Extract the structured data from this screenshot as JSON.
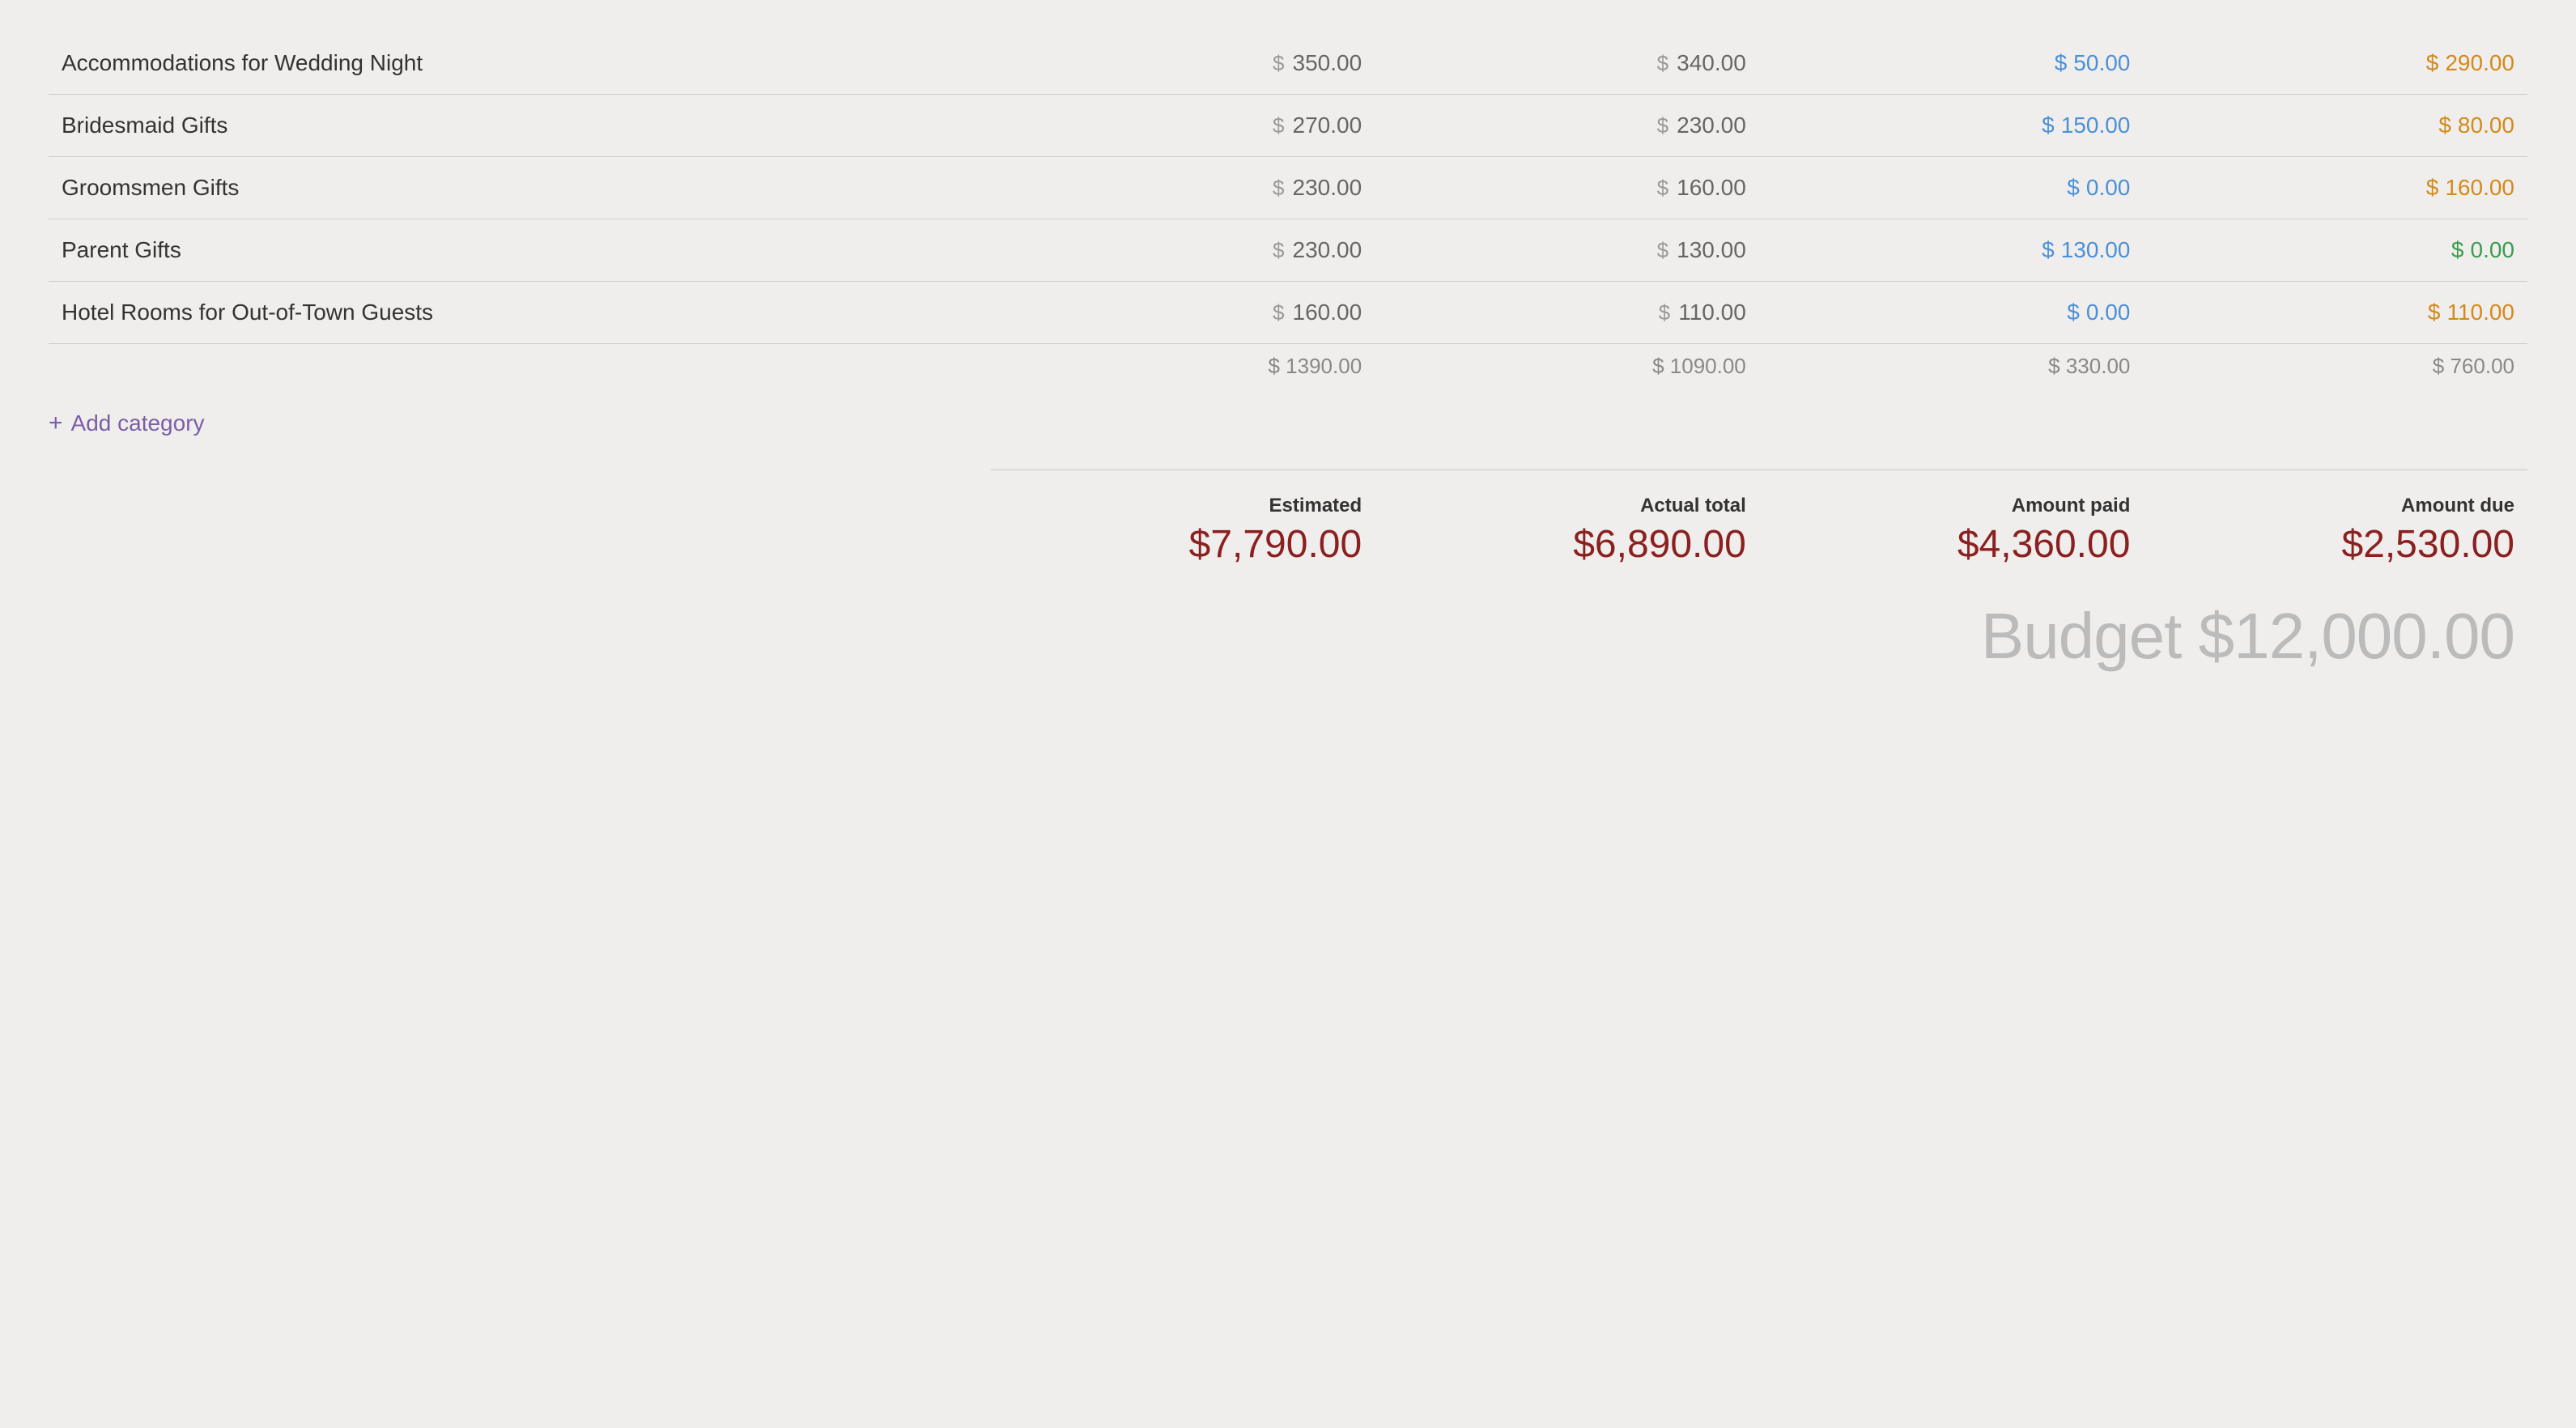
{
  "rows": [
    {
      "name": "Accommodations for Wedding Night",
      "estimated": "350.00",
      "actual": "340.00",
      "paid": "50.00",
      "due": "290.00",
      "paid_color": "blue",
      "due_color": "orange"
    },
    {
      "name": "Bridesmaid Gifts",
      "estimated": "270.00",
      "actual": "230.00",
      "paid": "150.00",
      "due": "80.00",
      "paid_color": "blue",
      "due_color": "orange"
    },
    {
      "name": "Groomsmen Gifts",
      "estimated": "230.00",
      "actual": "160.00",
      "paid": "0.00",
      "due": "160.00",
      "paid_color": "blue",
      "due_color": "orange"
    },
    {
      "name": "Parent Gifts",
      "estimated": "230.00",
      "actual": "130.00",
      "paid": "130.00",
      "due": "0.00",
      "paid_color": "blue",
      "due_color": "green"
    },
    {
      "name": "Hotel Rooms for Out-of-Town Guests",
      "estimated": "160.00",
      "actual": "110.00",
      "paid": "0.00",
      "due": "110.00",
      "paid_color": "blue",
      "due_color": "orange"
    }
  ],
  "totals": {
    "estimated": "$ 1390.00",
    "actual": "$ 1090.00",
    "paid": "$ 330.00",
    "due": "$ 760.00"
  },
  "add_category_label": "Add category",
  "summary": {
    "estimated_label": "Estimated",
    "estimated_value": "$7,790.00",
    "actual_label": "Actual total",
    "actual_value": "$6,890.00",
    "paid_label": "Amount paid",
    "paid_value": "$4,360.00",
    "due_label": "Amount due",
    "due_value": "$2,530.00"
  },
  "budget_total": "Budget $12,000.00",
  "currency_symbol": "$"
}
